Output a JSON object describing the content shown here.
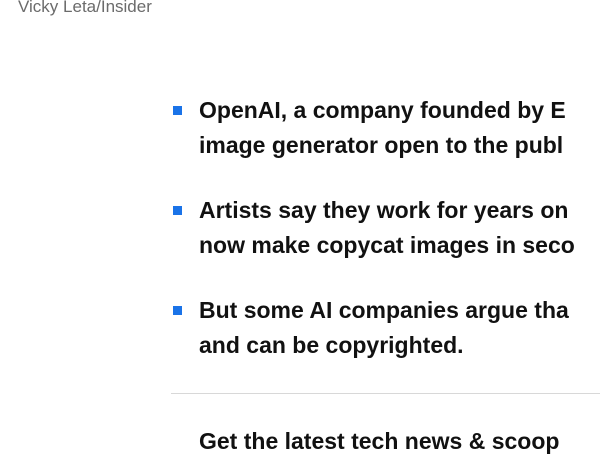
{
  "photo_credit": "Vicky Leta/Insider",
  "key_points": [
    {
      "line1": "OpenAI, a company founded by E",
      "line2": "image generator open to the publ"
    },
    {
      "line1": "Artists say they work for years on",
      "line2": "now make copycat images in seco"
    },
    {
      "line1": "But some AI companies argue tha",
      "line2": "and can be copyrighted."
    }
  ],
  "newsletter": {
    "heading": "Get the latest tech news & scoop"
  },
  "colors": {
    "bullet": "#1a73e8",
    "text": "#111111",
    "credit": "#6b6b6b",
    "divider": "#d8d8d8"
  }
}
